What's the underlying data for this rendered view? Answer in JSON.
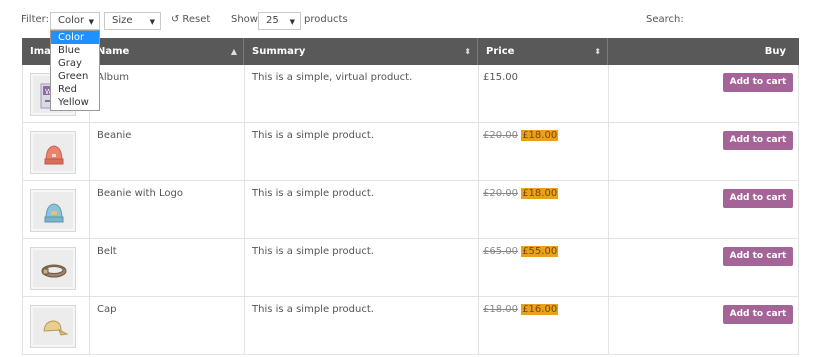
{
  "filters": {
    "label": "Filter:",
    "color_select": "Color",
    "size_select": "Size",
    "reset": "Reset",
    "color_options": [
      "Color",
      "Blue",
      "Gray",
      "Green",
      "Red",
      "Yellow"
    ]
  },
  "length": {
    "show_label": "Show",
    "value": "25",
    "products_label": "products"
  },
  "search": {
    "label": "Search:"
  },
  "table": {
    "headers": {
      "image": "Ima",
      "name": "Name",
      "summary": "Summary",
      "price": "Price",
      "buy": "Buy"
    },
    "rows": [
      {
        "name": "Album",
        "summary": "This is a simple, virtual product.",
        "price": "£15.00",
        "old_price": "",
        "sale_price": "",
        "button": "Add to cart",
        "icon": "album-icon"
      },
      {
        "name": "Beanie",
        "summary": "This is a simple product.",
        "price": "",
        "old_price": "£20.00",
        "sale_price": "£18.00",
        "button": "Add to cart",
        "icon": "beanie-icon"
      },
      {
        "name": "Beanie with Logo",
        "summary": "This is a simple product.",
        "price": "",
        "old_price": "£20.00",
        "sale_price": "£18.00",
        "button": "Add to cart",
        "icon": "beanie-logo-icon"
      },
      {
        "name": "Belt",
        "summary": "This is a simple product.",
        "price": "",
        "old_price": "£65.00",
        "sale_price": "£55.00",
        "button": "Add to cart",
        "icon": "belt-icon"
      },
      {
        "name": "Cap",
        "summary": "This is a simple product.",
        "price": "",
        "old_price": "£18.00",
        "sale_price": "£16.00",
        "button": "Add to cart",
        "icon": "cap-icon"
      }
    ]
  },
  "colors": {
    "header_bg": "#595959",
    "cart_button": "#a46497",
    "sale_highlight": "#e8a11d",
    "dropdown_selected": "#1e90ff"
  }
}
